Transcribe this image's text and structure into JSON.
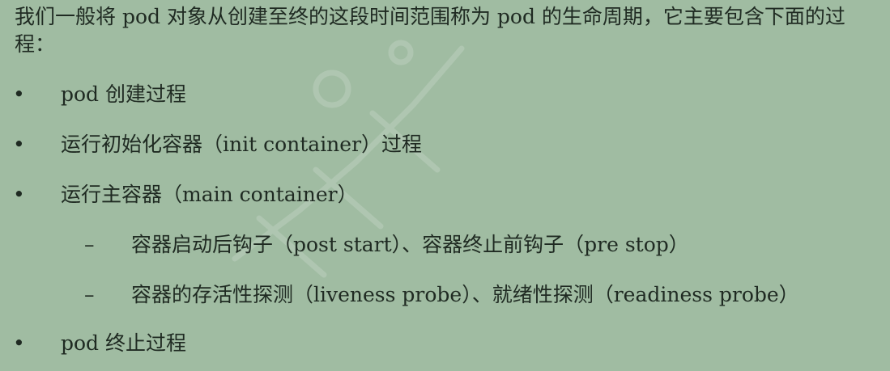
{
  "intro": "我们一般将 pod 对象从创建至终的这段时间范围称为 pod 的生命周期，它主要包含下面的过程：",
  "markers": {
    "bullet": "•",
    "dash": "–"
  },
  "items": [
    "pod 创建过程",
    "运行初始化容器（init container）过程",
    "运行主容器（main container）",
    "容器启动后钩子（post start）、容器终止前钩子（pre stop）",
    "容器的存活性探测（liveness  probe）、就绪性探测（readiness  probe）",
    "pod 终止过程"
  ]
}
